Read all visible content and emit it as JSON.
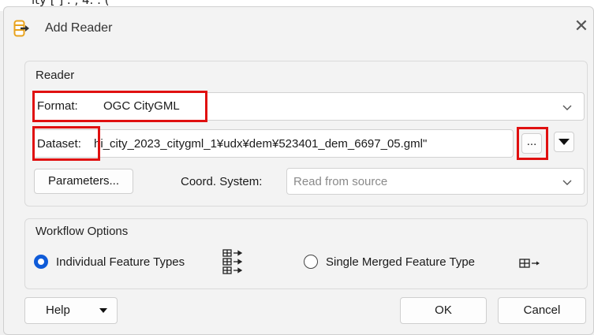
{
  "background_text": "ity  [   ]  .  , 4.  . (",
  "dialog": {
    "title": "Add Reader",
    "icon": "add-reader-icon",
    "close_icon": "close-icon"
  },
  "reader": {
    "group_title": "Reader",
    "format_label": "Format:",
    "format_value": "OGC CityGML",
    "dataset_label": "Dataset:",
    "dataset_value": "hi_city_2023_citygml_1¥udx¥dem¥523401_dem_6697_05.gml\"",
    "browse_label": "...",
    "parameters_label": "Parameters...",
    "coord_label": "Coord. System:",
    "coord_placeholder": "Read from source"
  },
  "workflow": {
    "group_title": "Workflow Options",
    "option_individual": "Individual Feature Types",
    "option_merged": "Single Merged Feature Type",
    "selected": "Individual Feature Types"
  },
  "buttons": {
    "help": "Help",
    "ok": "OK",
    "cancel": "Cancel"
  },
  "colors": {
    "highlight": "#e01010",
    "radio_selected": "#0f5bd8",
    "icon_orange": "#e8a21c"
  }
}
